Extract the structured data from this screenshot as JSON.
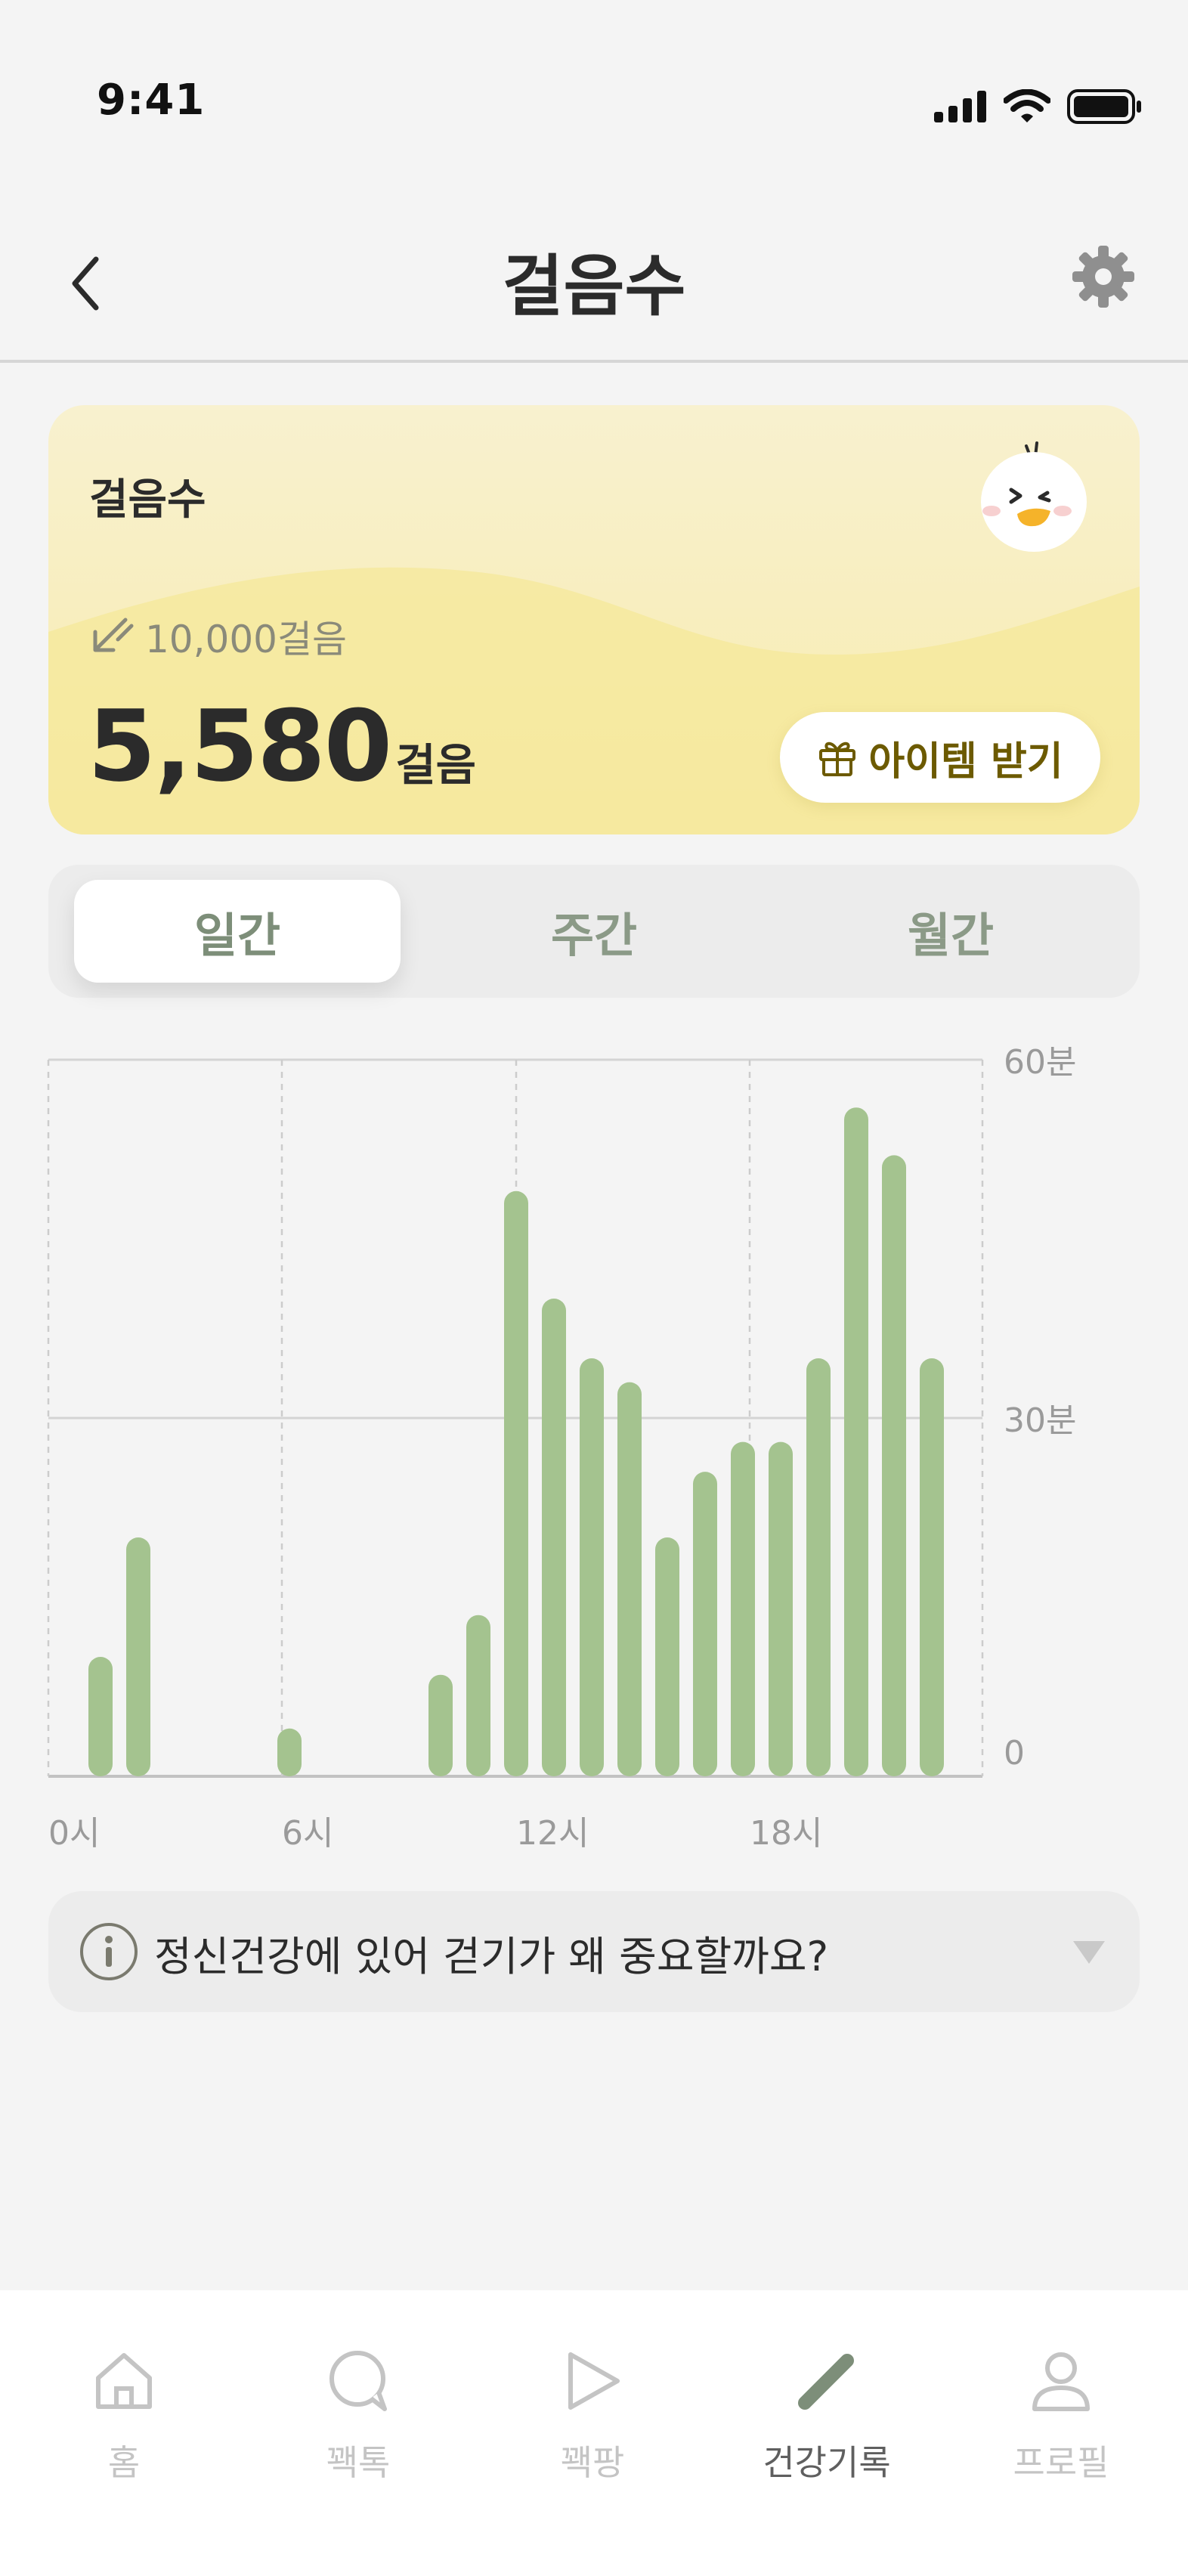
{
  "status_bar": {
    "time": "9:41"
  },
  "header": {
    "title": "걸음수"
  },
  "step_card": {
    "title": "걸음수",
    "goal": "10,000걸음",
    "steps_value": "5,580",
    "steps_unit": "걸음",
    "item_button_label": "아이템 받기"
  },
  "tabs": [
    {
      "label": "일간",
      "active": true
    },
    {
      "label": "주간",
      "active": false
    },
    {
      "label": "월간",
      "active": false
    }
  ],
  "chart_data": {
    "type": "bar",
    "x_tick_labels": [
      "0시",
      "6시",
      "12시",
      "18시"
    ],
    "y_tick_labels": [
      "60분",
      "30분",
      "0"
    ],
    "ylim": [
      0,
      60
    ],
    "categories": [
      "0",
      "1",
      "2",
      "3",
      "4",
      "5",
      "6",
      "7",
      "8",
      "9",
      "10",
      "11",
      "12",
      "13",
      "14",
      "15",
      "16",
      "17",
      "18",
      "19",
      "20",
      "21",
      "22",
      "23"
    ],
    "values": [
      0,
      10,
      20,
      0,
      0,
      0,
      4,
      0,
      0,
      0,
      8.5,
      13.5,
      49,
      40,
      35,
      33,
      20,
      25.5,
      28,
      28,
      35,
      56,
      52,
      35
    ],
    "bar_color": "#a4c38f",
    "grid": true
  },
  "info": {
    "text": "정신건강에 있어 걷기가 왜 중요할까요?"
  },
  "bottom_nav": [
    {
      "label": "홈",
      "icon": "home-icon",
      "active": false
    },
    {
      "label": "꽥톡",
      "icon": "chat-bubble-icon",
      "active": false
    },
    {
      "label": "꽥팡",
      "icon": "play-icon",
      "active": false
    },
    {
      "label": "건강기록",
      "icon": "pencil-icon",
      "active": true
    },
    {
      "label": "프로필",
      "icon": "person-icon",
      "active": false
    }
  ],
  "colors": {
    "background": "#f4f4f4",
    "card_yellow": "#f7ebae",
    "bar_green": "#a4c38f",
    "tab_text": "#8b9a87",
    "item_button_text": "#6c5a00"
  }
}
